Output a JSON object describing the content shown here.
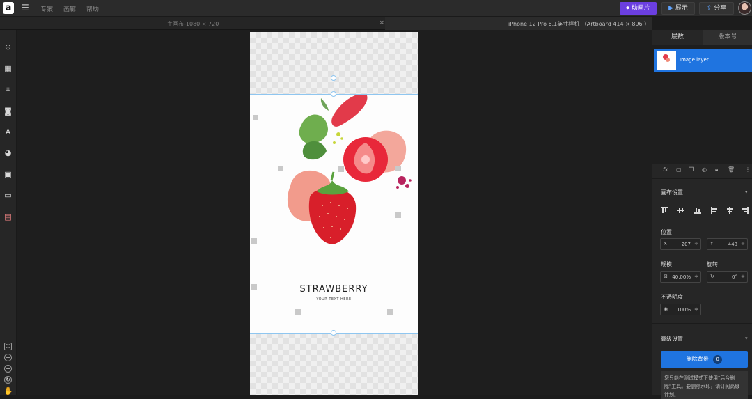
{
  "app": {
    "logo": "a"
  },
  "menu": {
    "items": [
      "专案",
      "画廊",
      "帮助"
    ]
  },
  "toolbar": {
    "animate_label": "动画片",
    "present_label": "展示",
    "share_label": "分享"
  },
  "tabs": {
    "main_canvas": "主画布-1080 × 720",
    "artboard": "iPhone 12 Pro 6.1英寸样机 （Artboard 414 × 896 ）"
  },
  "artboard": {
    "title": "STRAWBERRY",
    "subtitle": "YOUR TEXT HERE"
  },
  "panel": {
    "tab_layers": "层数",
    "tab_versions": "版本号",
    "layer_name": "Image layer",
    "canvas_settings": "画布设置",
    "position_label": "位置",
    "x_label": "X",
    "x_value": "207",
    "y_label": "Y",
    "y_value": "448",
    "scale_label": "规模",
    "scale_value": "40.00%",
    "rotate_label": "旋转",
    "rotate_value": "0°",
    "opacity_label": "不透明度",
    "opacity_value": "100%",
    "advanced": "高级设置",
    "remove_bg": "删除背景",
    "remove_count": "0",
    "note": "您只能在测试模式下使用\"后台删除\"工具。要删除水印，请订阅高级计划。"
  },
  "colors": {
    "accent": "#1f74e0",
    "animate": "#6b3fe0"
  }
}
